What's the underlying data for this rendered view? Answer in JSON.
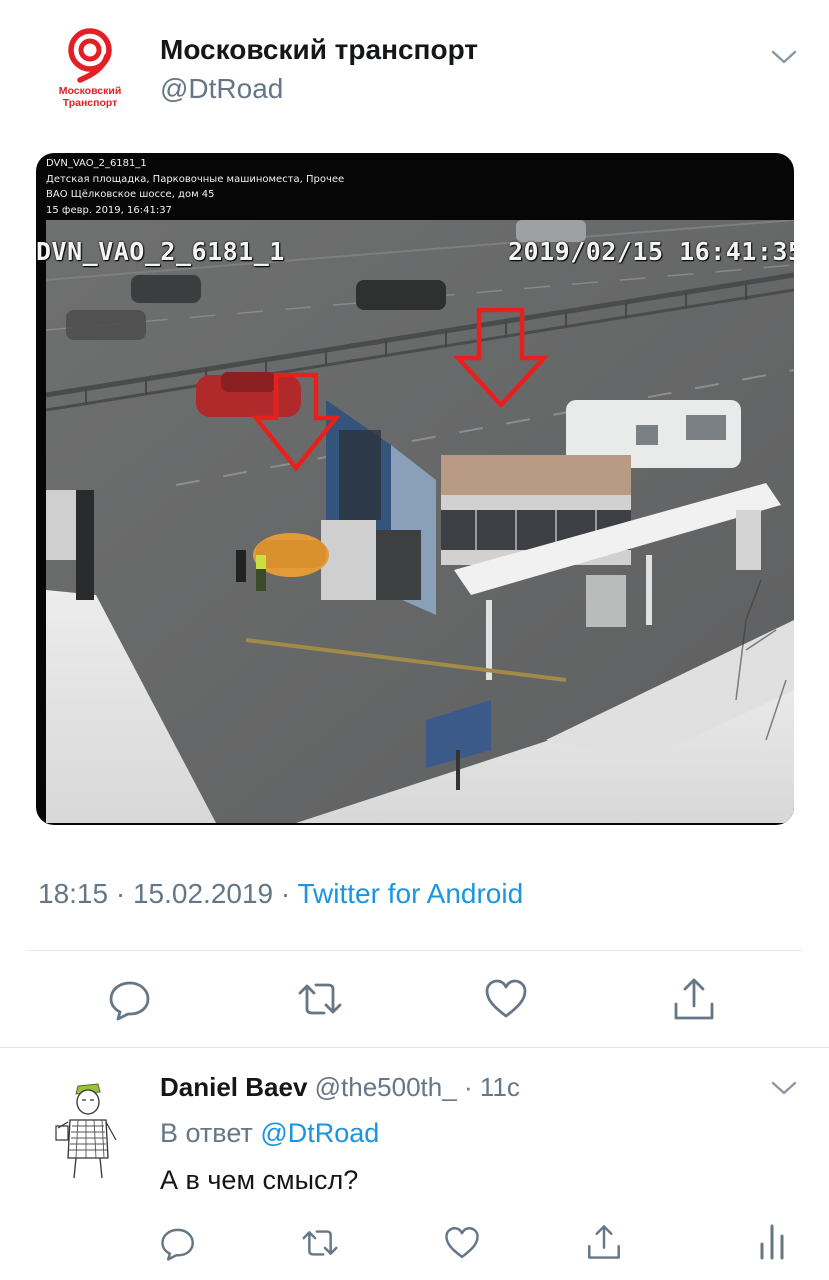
{
  "tweet": {
    "author_name": "Московский транспорт",
    "author_handle": "@DtRoad",
    "avatar": {
      "logo_line1": "Московский",
      "logo_line2": "Транспорт",
      "brand_color": "#e31e24"
    },
    "camera": {
      "info_lines": [
        "DVN_VAO_2_6181_1",
        "Детская площадка, Парковочные машиноместа, Прочее",
        "ВАО Щёлковское шоссе, дом 45",
        "15 февр. 2019, 16:41:37"
      ],
      "camera_id": "DVN_VAO_2_6181_1",
      "timestamp": "2019/02/15 16:41:35",
      "arrow_color": "#e8201d"
    },
    "time": "18:15",
    "date": "15.02.2019",
    "separator": "·",
    "source": "Twitter for Android"
  },
  "actions": {
    "icons": [
      "reply-icon",
      "retweet-icon",
      "like-icon",
      "share-icon"
    ],
    "icon_color": "#657786"
  },
  "reply": {
    "author_name": "Daniel Baev",
    "author_handle": "@the500th_",
    "separator": "·",
    "age": "11с",
    "in_reply_to_label": "В ответ",
    "in_reply_to_handle": "@DtRoad",
    "text": "А в чем смысл?",
    "action_icons": [
      "reply-icon",
      "retweet-icon",
      "like-icon",
      "share-icon",
      "analytics-icon"
    ]
  },
  "colors": {
    "text": "#14171a",
    "muted": "#657786",
    "link": "#1b95e0",
    "divider": "#e1e8ed"
  }
}
